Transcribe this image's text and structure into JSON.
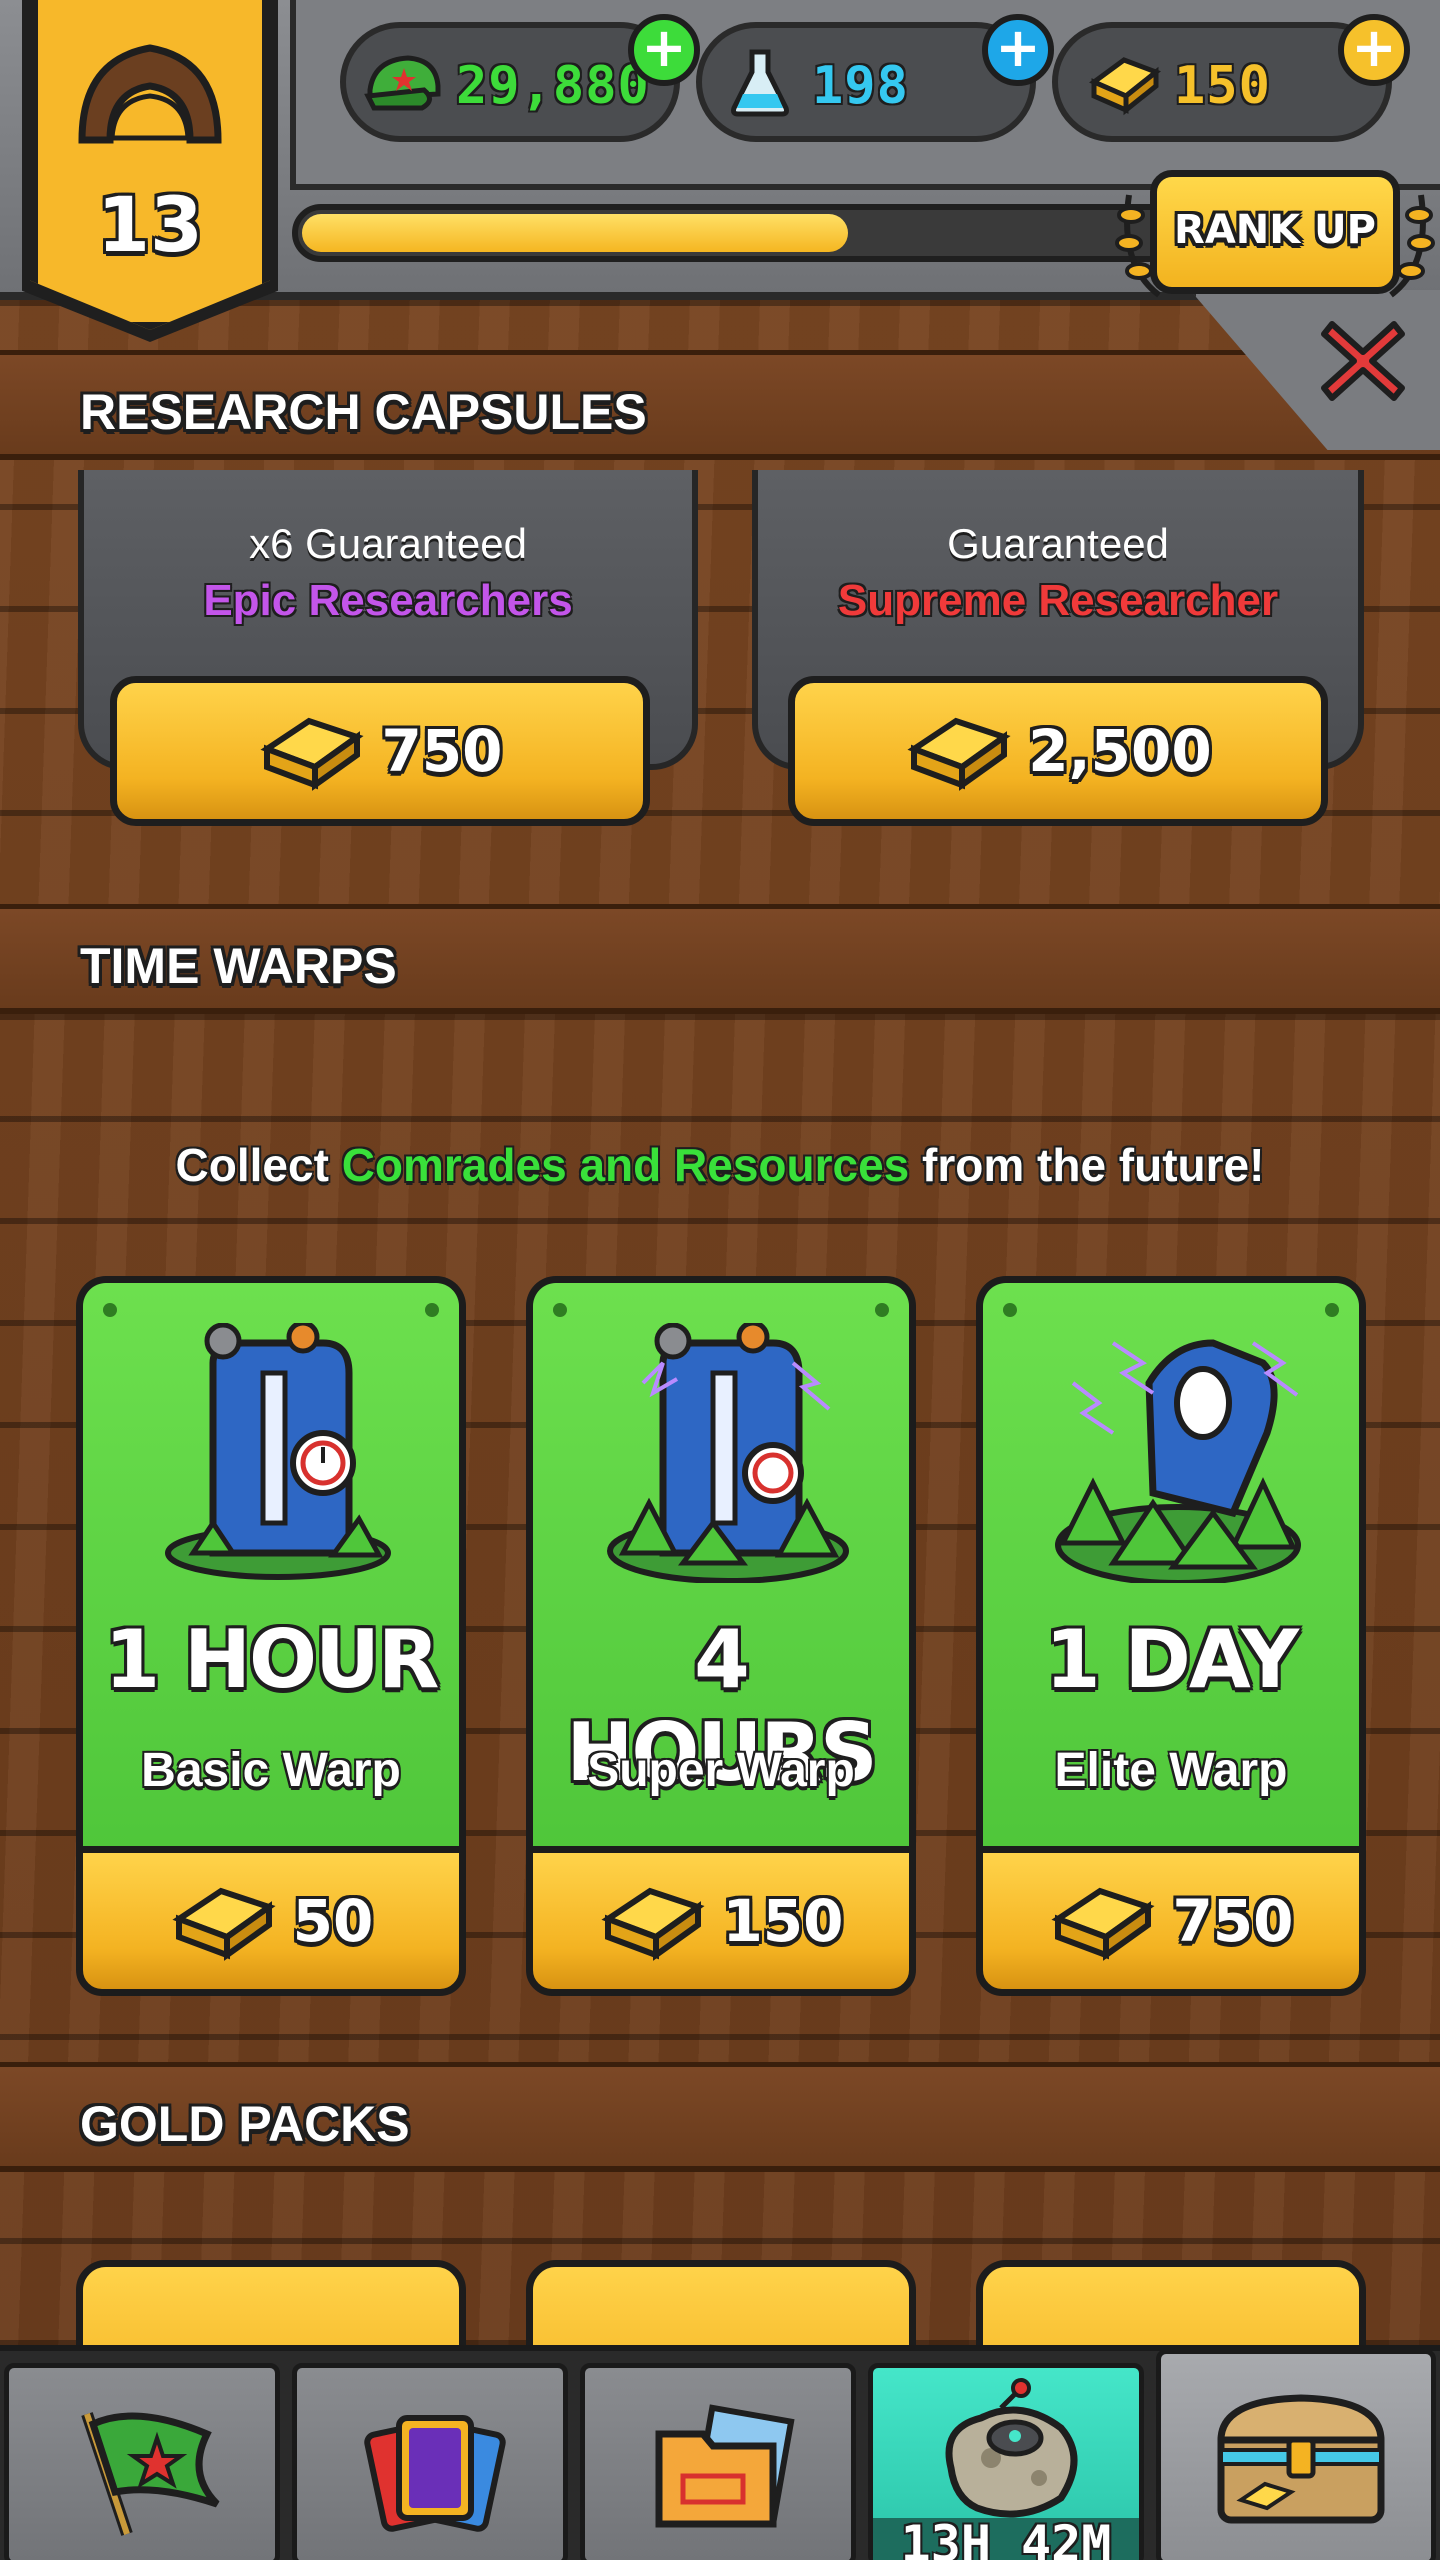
{
  "header": {
    "rank_number": "13",
    "currencies": [
      {
        "name": "cash",
        "value": "29,880",
        "color": "#3ddc3a",
        "icon": "army-cap-icon"
      },
      {
        "name": "science",
        "value": "198",
        "color": "#35c8f0",
        "icon": "flask-icon"
      },
      {
        "name": "gold",
        "value": "150",
        "color": "#f6c12b",
        "icon": "gold-bar-icon"
      }
    ],
    "rank_progress": 0.62,
    "rank_up_label": "RANK UP"
  },
  "sections": {
    "research_capsules": "RESEARCH CAPSULES",
    "time_warps": "TIME WARPS",
    "gold_packs": "GOLD PACKS"
  },
  "capsules": [
    {
      "line1": "x6 Guaranteed",
      "line2": "Epic Researchers",
      "line2_color": "#c355ea",
      "price": "750"
    },
    {
      "line1": "Guaranteed",
      "line2": "Supreme Researcher",
      "line2_color": "#f03a3a",
      "price": "2,500"
    }
  ],
  "time_warps": {
    "subtitle_pre": "Collect ",
    "subtitle_highlight": "Comrades and Resources",
    "subtitle_post": " from the future!",
    "cards": [
      {
        "duration": "1 HOUR",
        "name": "Basic Warp",
        "price": "50"
      },
      {
        "duration": "4 HOURS",
        "name": "Super Warp",
        "price": "150"
      },
      {
        "duration": "1 DAY",
        "name": "Elite Warp",
        "price": "750"
      }
    ]
  },
  "bottom_nav": {
    "tabs": [
      {
        "icon": "flag-icon"
      },
      {
        "icon": "cards-icon"
      },
      {
        "icon": "folder-icon"
      },
      {
        "icon": "asteroid-icon",
        "timer": "13H 42M"
      },
      {
        "icon": "treasure-chest-icon"
      }
    ]
  }
}
